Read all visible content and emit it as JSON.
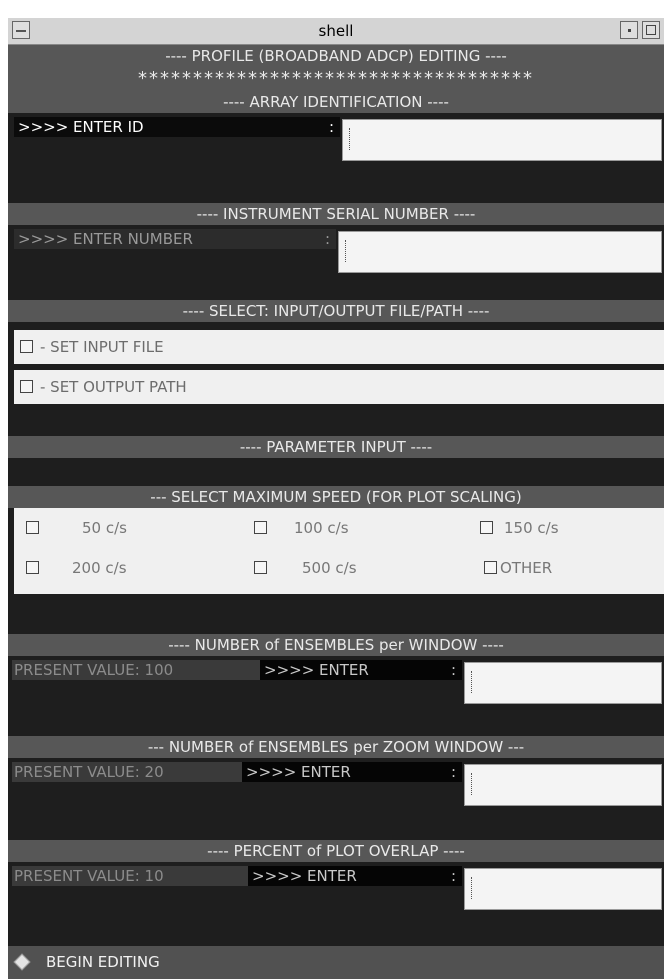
{
  "window": {
    "title": "shell"
  },
  "headings": {
    "profile": "---- PROFILE (BROADBAND ADCP) EDITING ----",
    "stars": "************************************",
    "array_id": "---- ARRAY IDENTIFICATION ----",
    "serial": "---- INSTRUMENT SERIAL NUMBER ----",
    "io": "---- SELECT: INPUT/OUTPUT FILE/PATH ----",
    "param": "---- PARAMETER INPUT ----",
    "max_speed": "--- SELECT MAXIMUM SPEED (FOR PLOT SCALING)",
    "ensembles": "---- NUMBER of ENSEMBLES per WINDOW ----",
    "zoom": "--- NUMBER of ENSEMBLES per ZOOM WINDOW ---",
    "overlap": "---- PERCENT of PLOT OVERLAP ----"
  },
  "array_id": {
    "prompt": ">>>> ENTER ID",
    "sep": ":",
    "value": ""
  },
  "serial": {
    "prompt": ">>>> ENTER NUMBER",
    "sep": ":",
    "value": ""
  },
  "io": {
    "input_file": "- SET INPUT FILE",
    "output_path": "- SET OUTPUT PATH"
  },
  "speeds": [
    "50 c/s",
    "100 c/s",
    "150 c/s",
    "200 c/s",
    "500 c/s",
    "OTHER"
  ],
  "ensembles": {
    "present": "PRESENT VALUE: 100",
    "enter": ">>>> ENTER",
    "sep": ":",
    "value": ""
  },
  "zoom": {
    "present": "PRESENT VALUE: 20",
    "enter": ">>>> ENTER",
    "sep": ":",
    "value": ""
  },
  "overlap": {
    "present": "PRESENT VALUE: 10",
    "enter": ">>>> ENTER",
    "sep": ":",
    "value": ""
  },
  "begin": {
    "label": "BEGIN EDITING"
  }
}
